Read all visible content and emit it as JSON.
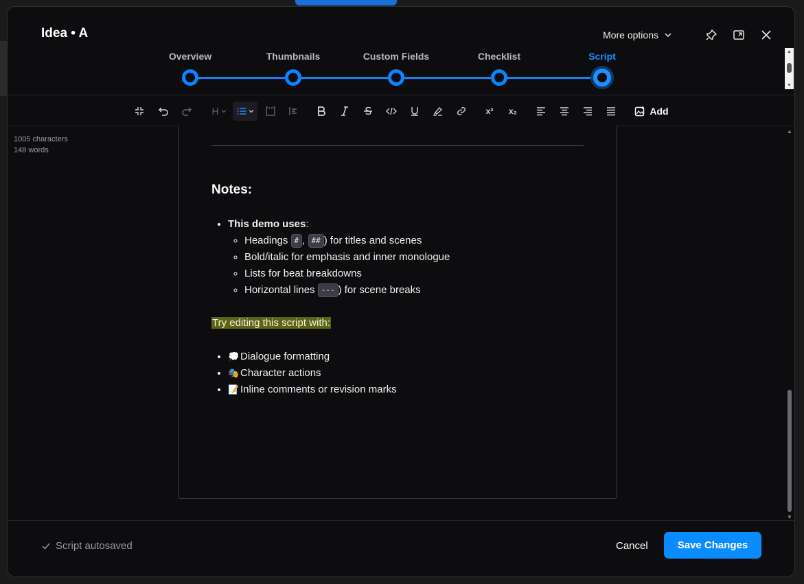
{
  "header": {
    "title": "Idea • A",
    "more_options_label": "More options"
  },
  "stepper": {
    "steps": [
      {
        "label": "Overview"
      },
      {
        "label": "Thumbnails"
      },
      {
        "label": "Custom Fields"
      },
      {
        "label": "Checklist"
      },
      {
        "label": "Script"
      }
    ],
    "active": "Script"
  },
  "toolbar": {
    "heading_label": "H",
    "superscript_label": "x²",
    "subscript_label": "x₂",
    "add_label": "Add"
  },
  "stats": {
    "characters": "1005 characters",
    "words": "148 words"
  },
  "document": {
    "heading": "Notes:",
    "demo_label": "This demo uses",
    "demo_colon": ":",
    "sub_items": {
      "headings_pre": "Headings ",
      "headings_code1": "#",
      "headings_mid": ", ",
      "headings_code2": "##",
      "headings_post": ") for titles and scenes",
      "bold": "Bold/italic for emphasis and inner monologue",
      "lists": "Lists for beat breakdowns",
      "hr_pre": "Horizontal lines ",
      "hr_code": "---",
      "hr_post": ") for scene breaks"
    },
    "highlight": "Try editing this script with:",
    "ideas": [
      {
        "emoji": "💭",
        "text": "Dialogue formatting"
      },
      {
        "emoji": "🎭",
        "text": "Character actions"
      },
      {
        "emoji": "📝",
        "text": "Inline comments or revision marks"
      }
    ]
  },
  "footer": {
    "autosave": "Script autosaved",
    "cancel": "Cancel",
    "save": "Save Changes"
  },
  "colors": {
    "accent": "#0a84ff",
    "highlight": "#5c6416",
    "background": "#0d0d0f"
  }
}
